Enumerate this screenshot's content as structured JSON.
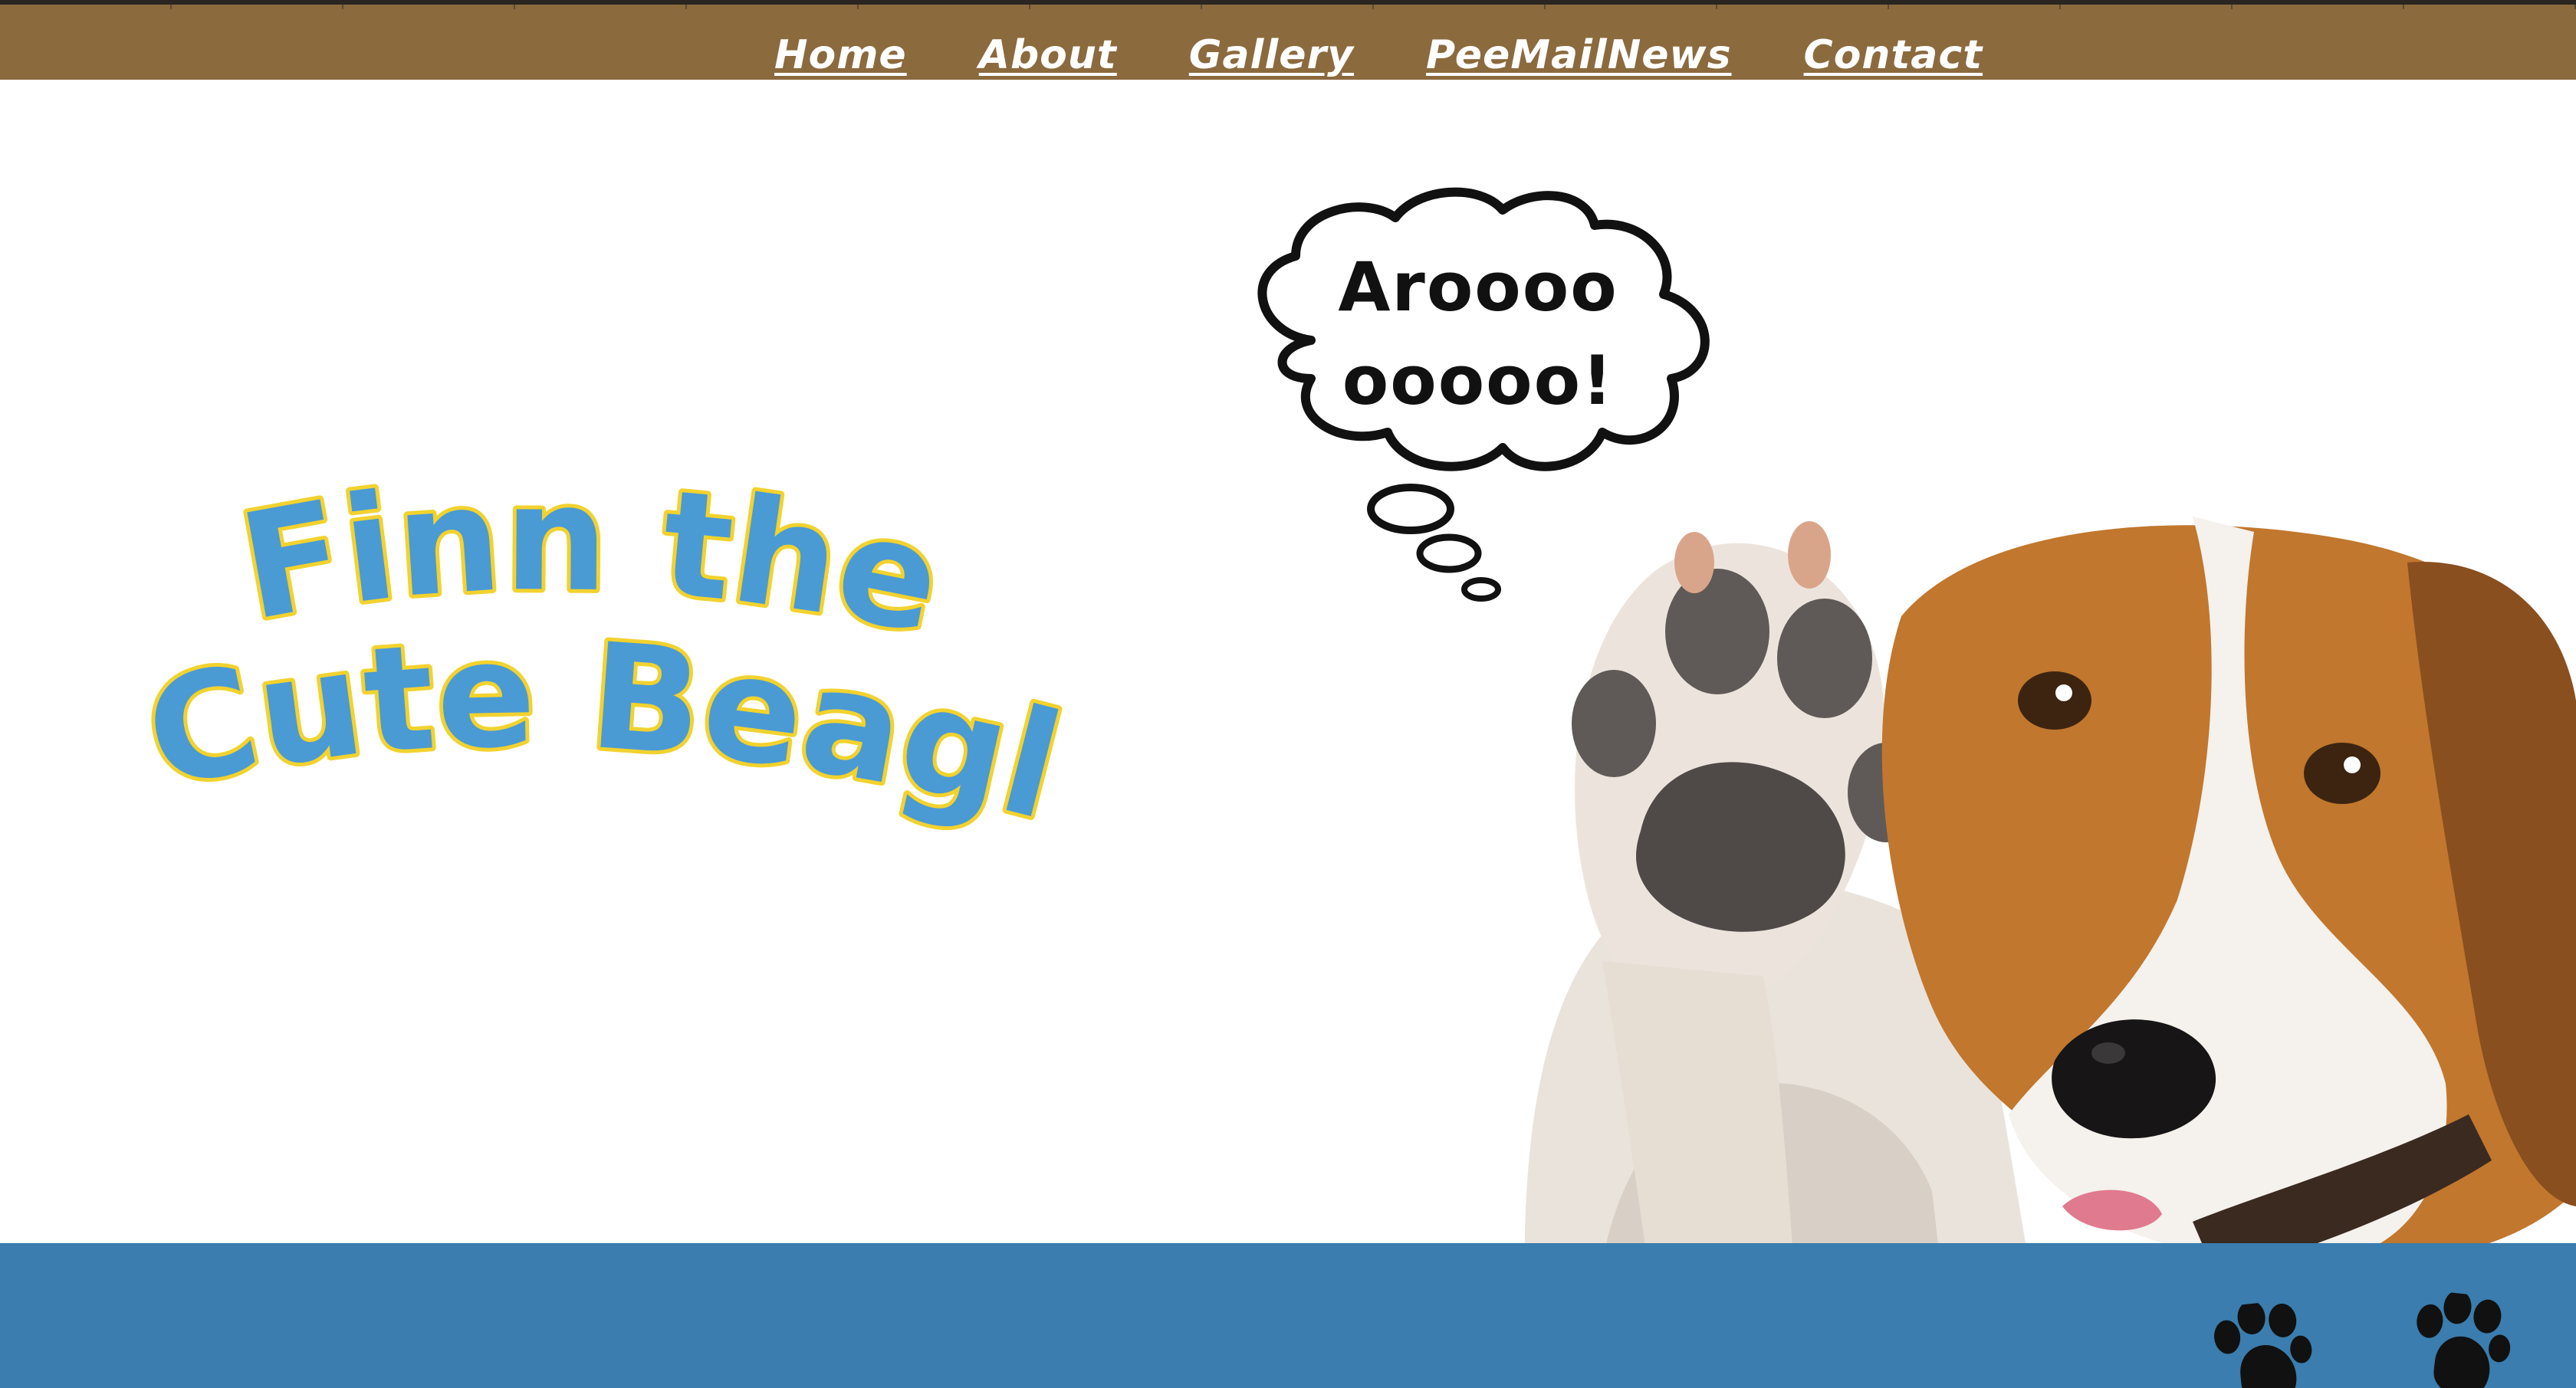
{
  "nav": {
    "items": [
      {
        "label": "Home"
      },
      {
        "label": "About"
      },
      {
        "label": "Gallery"
      },
      {
        "label": "PeeMailNews"
      },
      {
        "label": "Contact"
      }
    ]
  },
  "hero": {
    "logo_line1": "Finn the",
    "logo_line2": "Cute Beagle",
    "bubble_line1": "Aroooo",
    "bubble_line2": "ooooo!",
    "image_icon": "beagle-waving-paw-photo"
  },
  "footer": {
    "icons": [
      "paw-print-icon",
      "paw-print-icon"
    ]
  },
  "colors": {
    "nav_bg": "#8b6a3e",
    "footer_bg": "#3a7dae",
    "logo_fill": "#4a9ad4",
    "logo_outline": "#f2d22e"
  }
}
